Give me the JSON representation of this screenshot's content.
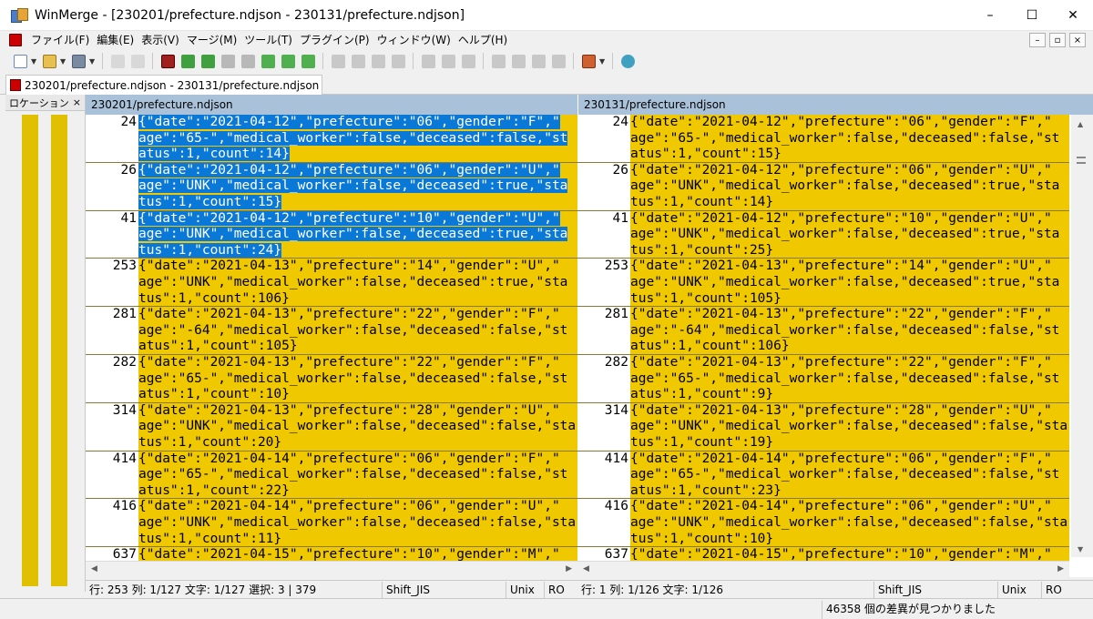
{
  "window": {
    "title": "WinMerge - [230201/prefecture.ndjson - 230131/prefecture.ndjson]",
    "minimize": "–",
    "maximize": "☐",
    "close": "✕"
  },
  "menu": [
    "ファイル(F)",
    "編集(E)",
    "表示(V)",
    "マージ(M)",
    "ツール(T)",
    "プラグイン(P)",
    "ウィンドウ(W)",
    "ヘルプ(H)"
  ],
  "mdi": {
    "minimize": "–",
    "restore": "▫",
    "close": "×"
  },
  "tab": {
    "label": "230201/prefecture.ndjson - 230131/prefecture.ndjson"
  },
  "location_pane": {
    "title": "ロケーション",
    "close": "×"
  },
  "left_pane": {
    "header": "230201/prefecture.ndjson",
    "rows": [
      {
        "num": "24",
        "lines": [
          "{\"date\":\"2021-04-12\",\"prefecture\":\"06\",\"gender\":\"F\",\"",
          "age\":\"65-\",\"medical_worker\":false,\"deceased\":false,\"st",
          "atus\":1,\"count\":14}"
        ],
        "selected": true
      },
      {
        "num": "26",
        "lines": [
          "{\"date\":\"2021-04-12\",\"prefecture\":\"06\",\"gender\":\"U\",\"",
          "age\":\"UNK\",\"medical_worker\":false,\"deceased\":true,\"sta",
          "tus\":1,\"count\":15}"
        ],
        "selected": true
      },
      {
        "num": "41",
        "lines": [
          "{\"date\":\"2021-04-12\",\"prefecture\":\"10\",\"gender\":\"U\",\"",
          "age\":\"UNK\",\"medical_worker\":false,\"deceased\":true,\"sta",
          "tus\":1,\"count\":24}"
        ],
        "selected": true
      },
      {
        "num": "253",
        "lines": [
          "{\"date\":\"2021-04-13\",\"prefecture\":\"14\",\"gender\":\"U\",\"",
          "age\":\"UNK\",\"medical_worker\":false,\"deceased\":true,\"sta",
          "tus\":1,\"count\":106}"
        ],
        "selected": false
      },
      {
        "num": "281",
        "lines": [
          "{\"date\":\"2021-04-13\",\"prefecture\":\"22\",\"gender\":\"F\",\"",
          "age\":\"-64\",\"medical_worker\":false,\"deceased\":false,\"st",
          "atus\":1,\"count\":105}"
        ],
        "selected": false
      },
      {
        "num": "282",
        "lines": [
          "{\"date\":\"2021-04-13\",\"prefecture\":\"22\",\"gender\":\"F\",\"",
          "age\":\"65-\",\"medical_worker\":false,\"deceased\":false,\"st",
          "atus\":1,\"count\":10}"
        ],
        "selected": false
      },
      {
        "num": "314",
        "lines": [
          "{\"date\":\"2021-04-13\",\"prefecture\":\"28\",\"gender\":\"U\",\"",
          "age\":\"UNK\",\"medical_worker\":false,\"deceased\":false,\"sta",
          "tus\":1,\"count\":20}"
        ],
        "selected": false
      },
      {
        "num": "414",
        "lines": [
          "{\"date\":\"2021-04-14\",\"prefecture\":\"06\",\"gender\":\"F\",\"",
          "age\":\"65-\",\"medical_worker\":false,\"deceased\":false,\"st",
          "atus\":1,\"count\":22}"
        ],
        "selected": false
      },
      {
        "num": "416",
        "lines": [
          "{\"date\":\"2021-04-14\",\"prefecture\":\"06\",\"gender\":\"U\",\"",
          "age\":\"UNK\",\"medical_worker\":false,\"deceased\":false,\"sta",
          "tus\":1,\"count\":11}"
        ],
        "selected": false
      },
      {
        "num": "637",
        "lines": [
          "{\"date\":\"2021-04-15\",\"prefecture\":\"10\",\"gender\":\"M\",\""
        ],
        "selected": false
      }
    ]
  },
  "right_pane": {
    "header": "230131/prefecture.ndjson",
    "rows": [
      {
        "num": "24",
        "lines": [
          "{\"date\":\"2021-04-12\",\"prefecture\":\"06\",\"gender\":\"F\",\"",
          "age\":\"65-\",\"medical_worker\":false,\"deceased\":false,\"st",
          "atus\":1,\"count\":15}"
        ]
      },
      {
        "num": "26",
        "lines": [
          "{\"date\":\"2021-04-12\",\"prefecture\":\"06\",\"gender\":\"U\",\"",
          "age\":\"UNK\",\"medical_worker\":false,\"deceased\":true,\"sta",
          "tus\":1,\"count\":14}"
        ]
      },
      {
        "num": "41",
        "lines": [
          "{\"date\":\"2021-04-12\",\"prefecture\":\"10\",\"gender\":\"U\",\"",
          "age\":\"UNK\",\"medical_worker\":false,\"deceased\":true,\"sta",
          "tus\":1,\"count\":25}"
        ]
      },
      {
        "num": "253",
        "lines": [
          "{\"date\":\"2021-04-13\",\"prefecture\":\"14\",\"gender\":\"U\",\"",
          "age\":\"UNK\",\"medical_worker\":false,\"deceased\":true,\"sta",
          "tus\":1,\"count\":105}"
        ]
      },
      {
        "num": "281",
        "lines": [
          "{\"date\":\"2021-04-13\",\"prefecture\":\"22\",\"gender\":\"F\",\"",
          "age\":\"-64\",\"medical_worker\":false,\"deceased\":false,\"st",
          "atus\":1,\"count\":106}"
        ]
      },
      {
        "num": "282",
        "lines": [
          "{\"date\":\"2021-04-13\",\"prefecture\":\"22\",\"gender\":\"F\",\"",
          "age\":\"65-\",\"medical_worker\":false,\"deceased\":false,\"st",
          "atus\":1,\"count\":9}"
        ]
      },
      {
        "num": "314",
        "lines": [
          "{\"date\":\"2021-04-13\",\"prefecture\":\"28\",\"gender\":\"U\",\"",
          "age\":\"UNK\",\"medical_worker\":false,\"deceased\":false,\"sta",
          "tus\":1,\"count\":19}"
        ]
      },
      {
        "num": "414",
        "lines": [
          "{\"date\":\"2021-04-14\",\"prefecture\":\"06\",\"gender\":\"F\",\"",
          "age\":\"65-\",\"medical_worker\":false,\"deceased\":false,\"st",
          "atus\":1,\"count\":23}"
        ]
      },
      {
        "num": "416",
        "lines": [
          "{\"date\":\"2021-04-14\",\"prefecture\":\"06\",\"gender\":\"U\",\"",
          "age\":\"UNK\",\"medical_worker\":false,\"deceased\":false,\"sta",
          "tus\":1,\"count\":10}"
        ]
      },
      {
        "num": "637",
        "lines": [
          "{\"date\":\"2021-04-15\",\"prefecture\":\"10\",\"gender\":\"M\",\""
        ]
      }
    ]
  },
  "status_left": {
    "position": "行: 253  列: 1/127  文字: 1/127  選択: 3 | 379",
    "encoding": "Shift_JIS",
    "eol": "Unix",
    "mode": "RO"
  },
  "status_right": {
    "position": "行: 1  列: 1/126  文字: 1/126",
    "encoding": "Shift_JIS",
    "eol": "Unix",
    "mode": "RO"
  },
  "bottom_message": "46358 個の差異が見つかりました",
  "colors": {
    "diff": "#f0c800",
    "selection": "#0a78d7",
    "pane_header": "#a9c2da"
  },
  "icons": [
    "new-icon",
    "open-icon",
    "save-icon",
    "undo-icon",
    "redo-icon",
    "filmstrip-icon",
    "next-diff-icon",
    "prev-diff-icon",
    "copy-right-icon",
    "copy-left-icon",
    "options-icon",
    "refresh-icon"
  ]
}
